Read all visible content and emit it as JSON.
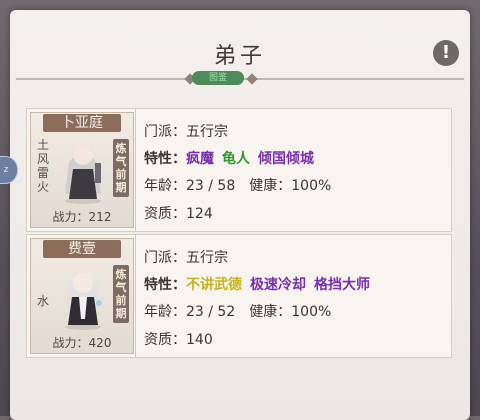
{
  "header": {
    "title": "弟子",
    "tag": "图鉴"
  },
  "side_tab": {
    "label": "z"
  },
  "labels": {
    "sect": "门派：",
    "traits": "特性：",
    "age": "年龄：",
    "health": "健康：",
    "aptitude": "资质："
  },
  "disciples": [
    {
      "name": "卜亚庭",
      "roots": [
        "土",
        "风",
        "雷",
        "火"
      ],
      "realm": "炼气前期",
      "power": "战力：212",
      "sect": "五行宗",
      "traits": [
        {
          "text": "疯魔",
          "color": "#7a2fb0"
        },
        {
          "text": "龟人",
          "color": "#2e9a2e"
        },
        {
          "text": "倾国倾城",
          "color": "#7a2fb0"
        }
      ],
      "age": "23 / 58",
      "health": "100%",
      "aptitude": "124"
    },
    {
      "name": "费壹",
      "roots": [
        "水"
      ],
      "realm": "炼气前期",
      "power": "战力：420",
      "sect": "五行宗",
      "traits": [
        {
          "text": "不讲武德",
          "color": "#c9b21a"
        },
        {
          "text": "极速冷却",
          "color": "#7a2fb0"
        },
        {
          "text": "格挡大师",
          "color": "#7a2fb0"
        }
      ],
      "age": "23 / 52",
      "health": "100%",
      "aptitude": "140"
    }
  ]
}
